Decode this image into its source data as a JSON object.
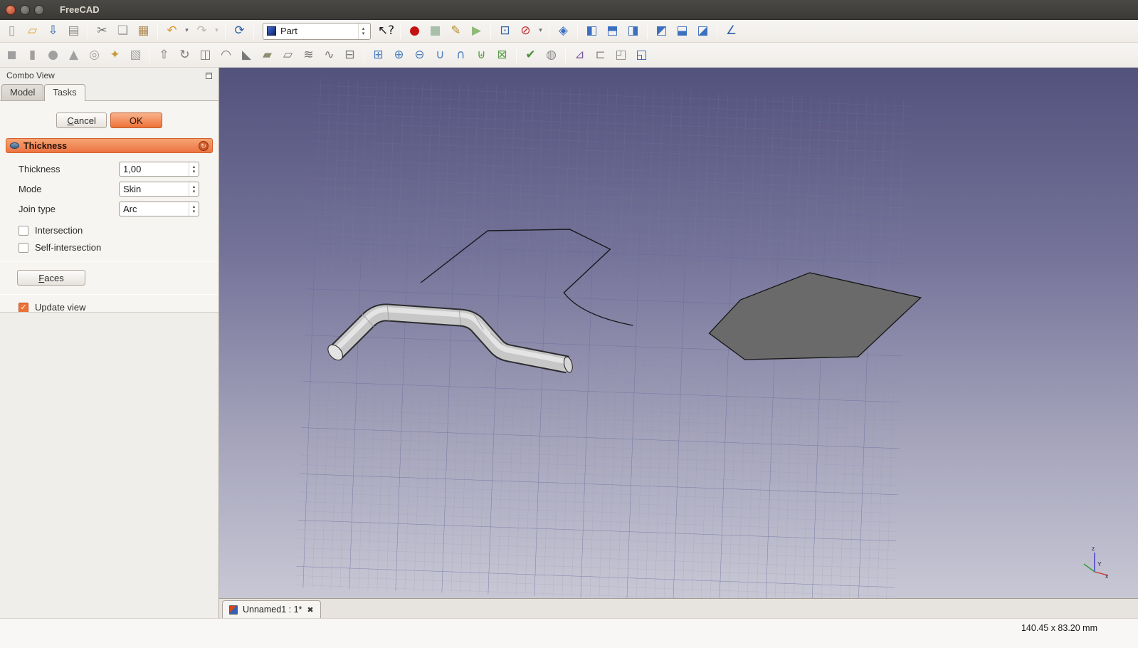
{
  "window": {
    "title": "FreeCAD"
  },
  "icons": {
    "check": "✓",
    "spin_up": "▴",
    "spin_down": "▾",
    "close_tab": "✖",
    "task_toggle": "↻"
  },
  "toolbars": {
    "workbench_label": "Part",
    "file_group": [
      {
        "kind": "btn",
        "name": "new-file-icon",
        "glyph": "▯",
        "color": "#9b9b9b"
      },
      {
        "kind": "btn",
        "name": "open-folder-icon",
        "glyph": "▱",
        "color": "#d9a43e"
      },
      {
        "kind": "btn",
        "name": "save-icon",
        "glyph": "⇩",
        "color": "#2f62a8"
      },
      {
        "kind": "btn",
        "name": "print-icon",
        "glyph": "▤",
        "color": "#8a8a8a"
      },
      {
        "kind": "sep",
        "name": "separator"
      },
      {
        "kind": "btn",
        "name": "cut-icon",
        "glyph": "✂",
        "color": "#6e6e6e"
      },
      {
        "kind": "btn",
        "name": "copy-icon",
        "glyph": "❏",
        "color": "#9a9a9a"
      },
      {
        "kind": "btn",
        "name": "paste-icon",
        "glyph": "▦",
        "color": "#b08b52"
      },
      {
        "kind": "sep",
        "name": "separator"
      },
      {
        "kind": "btn",
        "name": "undo-icon",
        "glyph": "↶",
        "color": "#e09a2f"
      },
      {
        "kind": "drop",
        "name": "undo-dropdown-icon",
        "glyph": "▾",
        "color": "#6b6b6b"
      },
      {
        "kind": "btn",
        "name": "redo-icon",
        "glyph": "↷",
        "color": "#bdb9b2"
      },
      {
        "kind": "drop",
        "name": "redo-dropdown-icon",
        "glyph": "▾",
        "color": "#bdb9b2"
      },
      {
        "kind": "sep",
        "name": "separator"
      },
      {
        "kind": "btn",
        "name": "refresh-icon",
        "glyph": "⟳",
        "color": "#2f62a8"
      },
      {
        "kind": "sep",
        "name": "separator"
      }
    ],
    "view_group": [
      {
        "kind": "btn",
        "name": "whats-this-icon",
        "glyph": "↖?",
        "color": "#1a1a1a"
      },
      {
        "kind": "sep",
        "name": "separator"
      },
      {
        "kind": "btn",
        "name": "macro-record-icon",
        "glyph": "●",
        "color": "#c41111"
      },
      {
        "kind": "btn",
        "name": "macro-stop-icon",
        "glyph": "■",
        "color": "#a9bfa9"
      },
      {
        "kind": "btn",
        "name": "macro-edit-icon",
        "glyph": "✎",
        "color": "#bb8d33"
      },
      {
        "kind": "btn",
        "name": "macro-execute-icon",
        "glyph": "▶",
        "color": "#8fba75"
      },
      {
        "kind": "sep",
        "name": "separator"
      },
      {
        "kind": "btn",
        "name": "zoom-fit-icon",
        "glyph": "⊡",
        "color": "#2f62a8"
      },
      {
        "kind": "btn",
        "name": "draw-style-icon",
        "glyph": "⊘",
        "color": "#c23030"
      },
      {
        "kind": "drop",
        "name": "draw-style-dropdown-icon",
        "glyph": "▾",
        "color": "#6b6b6b"
      },
      {
        "kind": "sep",
        "name": "separator"
      },
      {
        "kind": "btn",
        "name": "axonometric-view-icon",
        "glyph": "◈",
        "color": "#3b6fc0"
      },
      {
        "kind": "sep",
        "name": "separator"
      },
      {
        "kind": "btn",
        "name": "front-view-icon",
        "glyph": "◧",
        "color": "#3b6fc0"
      },
      {
        "kind": "btn",
        "name": "top-view-icon",
        "glyph": "⬒",
        "color": "#3b6fc0"
      },
      {
        "kind": "btn",
        "name": "right-view-icon",
        "glyph": "◨",
        "color": "#3b6fc0"
      },
      {
        "kind": "sep",
        "name": "separator"
      },
      {
        "kind": "btn",
        "name": "rear-view-icon",
        "glyph": "◩",
        "color": "#3b6fc0"
      },
      {
        "kind": "btn",
        "name": "bottom-view-icon",
        "glyph": "⬓",
        "color": "#3b6fc0"
      },
      {
        "kind": "btn",
        "name": "left-view-icon",
        "glyph": "◪",
        "color": "#3b6fc0"
      },
      {
        "kind": "sep",
        "name": "separator"
      },
      {
        "kind": "btn",
        "name": "measure-distance-icon",
        "glyph": "∠",
        "color": "#2f62a8"
      }
    ],
    "part_tools": [
      {
        "kind": "btn",
        "name": "box-icon",
        "glyph": "◼",
        "color": "#a0a0a0"
      },
      {
        "kind": "btn",
        "name": "cylinder-icon",
        "glyph": "▮",
        "color": "#a0a0a0"
      },
      {
        "kind": "btn",
        "name": "sphere-icon",
        "glyph": "●",
        "color": "#a0a0a0"
      },
      {
        "kind": "btn",
        "name": "cone-icon",
        "glyph": "▲",
        "color": "#a0a0a0"
      },
      {
        "kind": "btn",
        "name": "torus-icon",
        "glyph": "◎",
        "color": "#a0a0a0"
      },
      {
        "kind": "btn",
        "name": "primitives-icon",
        "glyph": "✦",
        "color": "#c79a35"
      },
      {
        "kind": "btn",
        "name": "shape-builder-icon",
        "glyph": "▧",
        "color": "#a0a0a0"
      },
      {
        "kind": "sep",
        "name": "separator"
      },
      {
        "kind": "btn",
        "name": "extrude-icon",
        "glyph": "⇧",
        "color": "#787878"
      },
      {
        "kind": "btn",
        "name": "revolve-icon",
        "glyph": "↻",
        "color": "#787878"
      },
      {
        "kind": "btn",
        "name": "mirror-icon",
        "glyph": "◫",
        "color": "#787878"
      },
      {
        "kind": "btn",
        "name": "fillet-icon",
        "glyph": "◠",
        "color": "#787878"
      },
      {
        "kind": "btn",
        "name": "chamfer-icon",
        "glyph": "◣",
        "color": "#787878"
      },
      {
        "kind": "btn",
        "name": "make-face-icon",
        "glyph": "▰",
        "color": "#8f8f72"
      },
      {
        "kind": "btn",
        "name": "ruled-surface-icon",
        "glyph": "▱",
        "color": "#787878"
      },
      {
        "kind": "btn",
        "name": "loft-icon",
        "glyph": "≋",
        "color": "#787878"
      },
      {
        "kind": "btn",
        "name": "sweep-icon",
        "glyph": "∿",
        "color": "#787878"
      },
      {
        "kind": "btn",
        "name": "section-icon",
        "glyph": "⊟",
        "color": "#787878"
      },
      {
        "kind": "sep",
        "name": "separator"
      },
      {
        "kind": "btn",
        "name": "compound-icon",
        "glyph": "⊞",
        "color": "#4d7fbe"
      },
      {
        "kind": "btn",
        "name": "boolean-icon",
        "glyph": "⊕",
        "color": "#4d7fbe"
      },
      {
        "kind": "btn",
        "name": "boolean-cut-icon",
        "glyph": "⊖",
        "color": "#4d7fbe"
      },
      {
        "kind": "btn",
        "name": "union-icon",
        "glyph": "∪",
        "color": "#4d7fbe"
      },
      {
        "kind": "btn",
        "name": "intersection-icon",
        "glyph": "∩",
        "color": "#4d7fbe"
      },
      {
        "kind": "btn",
        "name": "connect-icon",
        "glyph": "⊎",
        "color": "#5d9e49"
      },
      {
        "kind": "btn",
        "name": "split-icon",
        "glyph": "⊠",
        "color": "#5d9e49"
      },
      {
        "kind": "sep",
        "name": "separator"
      },
      {
        "kind": "btn",
        "name": "check-geometry-icon",
        "glyph": "✔",
        "color": "#4d8f3c"
      },
      {
        "kind": "btn",
        "name": "defeaturing-icon",
        "glyph": "◍",
        "color": "#8a8a8a"
      },
      {
        "kind": "sep",
        "name": "separator"
      },
      {
        "kind": "btn",
        "name": "cross-sections-icon",
        "glyph": "⊿",
        "color": "#7a5aa0"
      },
      {
        "kind": "btn",
        "name": "offset-3d-icon",
        "glyph": "⊏",
        "color": "#8a8a8a"
      },
      {
        "kind": "btn",
        "name": "offset-2d-icon",
        "glyph": "◰",
        "color": "#8a8a8a"
      },
      {
        "kind": "btn",
        "name": "thickness-icon",
        "glyph": "◱",
        "color": "#2f62a8"
      }
    ]
  },
  "combo_view": {
    "title": "Combo View",
    "tabs": [
      {
        "label": "Model"
      },
      {
        "label": "Tasks"
      }
    ],
    "cancel_label": "Cancel",
    "ok_label": "OK",
    "task": {
      "header_title": "Thickness",
      "thickness_label": "Thickness",
      "thickness_value": "1,00",
      "mode_label": "Mode",
      "mode_value": "Skin",
      "join_type_label": "Join type",
      "join_type_value": "Arc",
      "intersection_label": "Intersection",
      "intersection_checked": false,
      "self_intersection_label": "Self-intersection",
      "self_intersection_checked": false,
      "faces_label": "Faces",
      "update_view_label": "Update view",
      "update_view_checked": true
    }
  },
  "viewport": {
    "document_tab_label": "Unnamed1 : 1*",
    "axes": {
      "x_label": "x",
      "y_label": "Y",
      "z_label": "z"
    }
  },
  "status_bar": {
    "dimensions_label": "140.45 x 83.20 mm"
  },
  "colors": {
    "accent": "#ee7136",
    "accent_dark": "#ec7442",
    "viewport_top": "#53527d",
    "viewport_bottom": "#ccccd8"
  }
}
